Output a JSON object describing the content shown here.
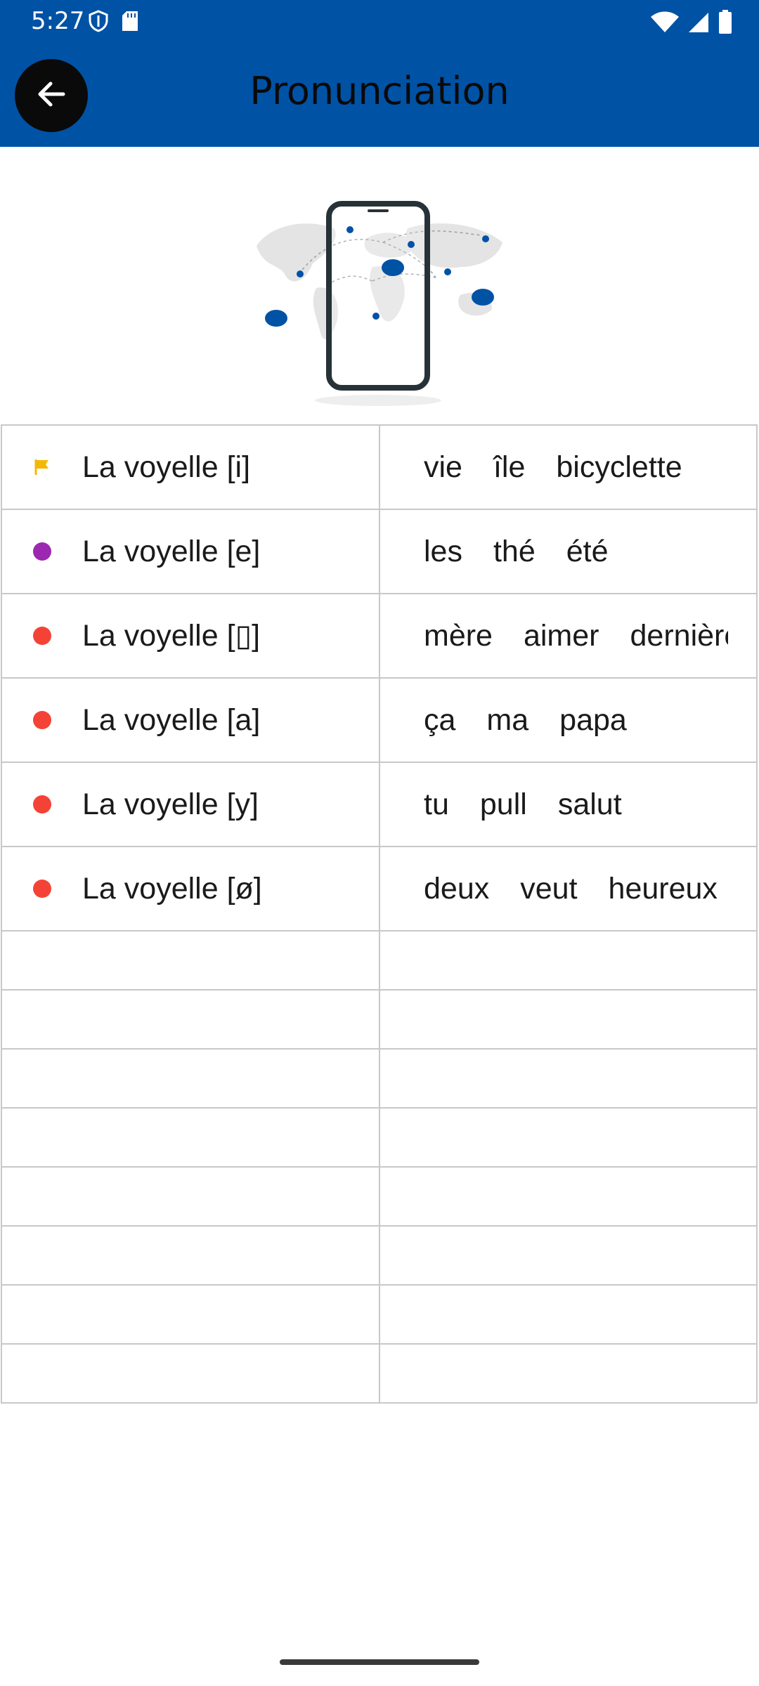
{
  "status_bar": {
    "time": "5:27",
    "left_icons": [
      "shield-icon",
      "sd-card-icon"
    ],
    "right_icons": [
      "wifi-icon",
      "cell-signal-icon",
      "battery-icon"
    ]
  },
  "app_bar": {
    "title": "Pronunciation",
    "back_icon": "arrow-back-icon",
    "color": "#0052a5"
  },
  "illustration": {
    "icon": "phone-world-map-illustration"
  },
  "vowels": [
    {
      "marker": "flag",
      "color": "#f5b800",
      "label": "La voyelle [i]",
      "examples": [
        "vie",
        "île",
        "bicyclette"
      ]
    },
    {
      "marker": "dot",
      "color": "#9c27b0",
      "label": "La voyelle [e]",
      "examples": [
        "les",
        "thé",
        "été"
      ]
    },
    {
      "marker": "dot",
      "color": "#f44336",
      "label": "La voyelle [▯]",
      "examples": [
        "mère",
        "aimer",
        "dernière"
      ]
    },
    {
      "marker": "dot",
      "color": "#f44336",
      "label": "La voyelle [a]",
      "examples": [
        "ça",
        "ma",
        "papa"
      ]
    },
    {
      "marker": "dot",
      "color": "#f44336",
      "label": "La voyelle [y]",
      "examples": [
        "tu",
        "pull",
        "salut"
      ]
    },
    {
      "marker": "dot",
      "color": "#f44336",
      "label": "La voyelle [ø]",
      "examples": [
        "deux",
        "veut",
        "heureux"
      ]
    }
  ]
}
